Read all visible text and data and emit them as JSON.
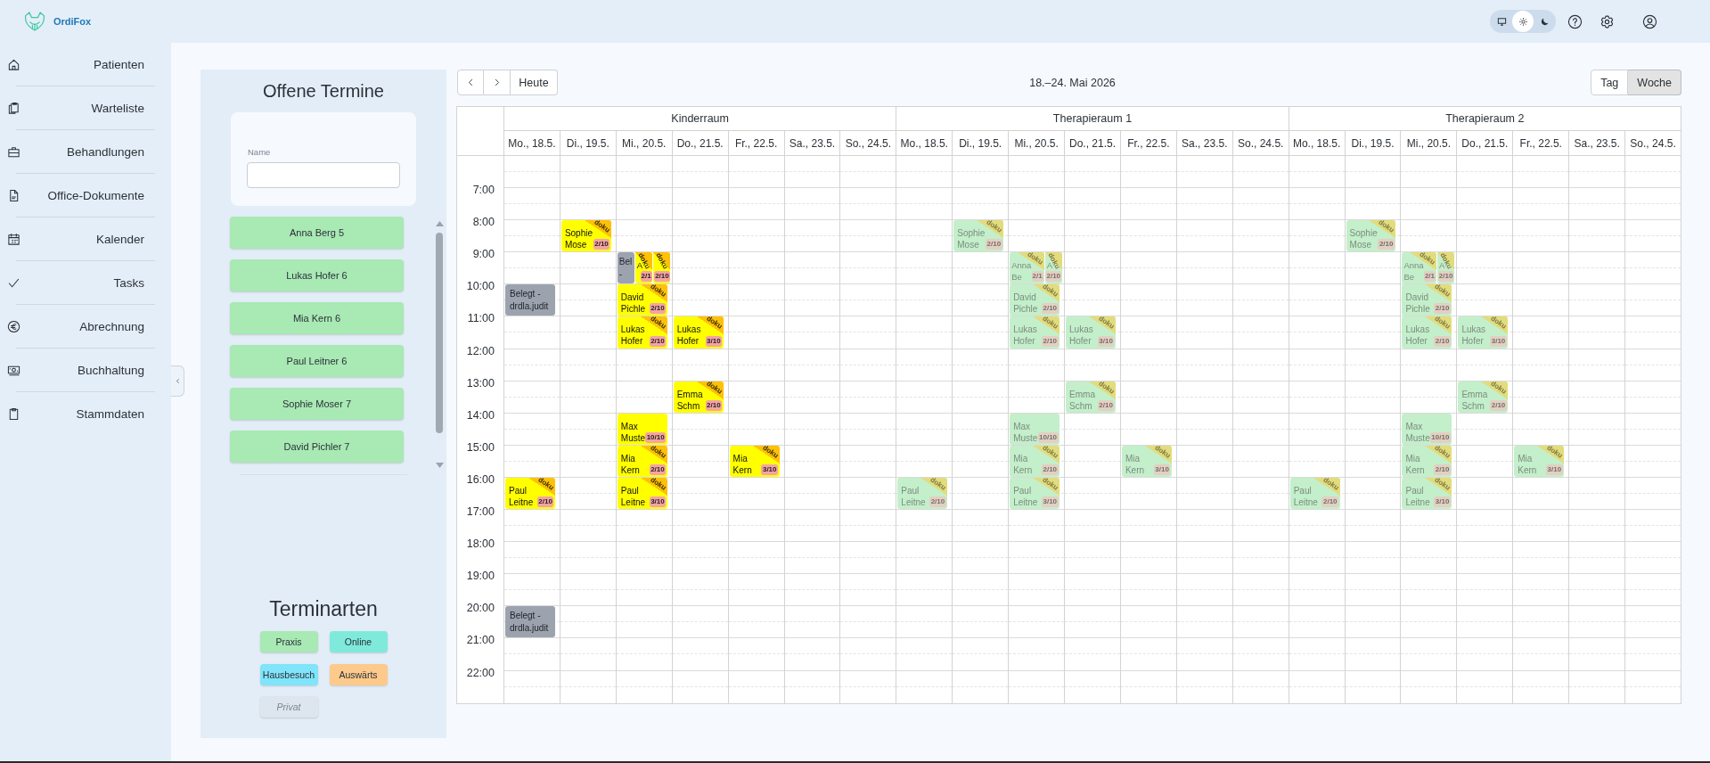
{
  "app": {
    "name": "OrdiFox"
  },
  "theme_modes": [
    {
      "kind": "system",
      "selected": false
    },
    {
      "kind": "light",
      "selected": true
    },
    {
      "kind": "dark",
      "selected": false
    }
  ],
  "sidebar": {
    "items": [
      "Patienten",
      "Warteliste",
      "Behandlungen",
      "Office-Dokumente",
      "Kalender",
      "Tasks",
      "Abrechnung",
      "Buchhaltung",
      "Stammdaten"
    ]
  },
  "open_appointments": {
    "title": "Offene Termine",
    "search_label": "Name",
    "items": [
      "Anna Berg 5",
      "Lukas Hofer 6",
      "Mia Kern 6",
      "Paul Leitner 6",
      "Sophie Moser 7",
      "David Pichler 7"
    ]
  },
  "appointment_types": {
    "title": "Terminarten",
    "items": [
      {
        "label": "Praxis",
        "color": "#a8e9b4",
        "disabled": false
      },
      {
        "label": "Online",
        "color": "#7feadb",
        "disabled": false
      },
      {
        "label": "Hausbesuch",
        "color": "#80e4fa",
        "disabled": false
      },
      {
        "label": "Auswärts",
        "color": "#fdca8c",
        "disabled": false
      },
      {
        "label": "Privat",
        "color": "#dde6ee",
        "disabled": true
      }
    ]
  },
  "calendar": {
    "today": "Heute",
    "title": "18.–24. Mai 2026",
    "views": [
      {
        "label": "Tag",
        "selected": false
      },
      {
        "label": "Woche",
        "selected": true
      }
    ],
    "time_labels": [
      "7:00",
      "8:00",
      "9:00",
      "10:00",
      "11:00",
      "12:00",
      "13:00",
      "14:00",
      "15:00",
      "16:00",
      "17:00",
      "18:00",
      "19:00",
      "20:00",
      "21:00",
      "22:00"
    ],
    "rooms": [
      {
        "name": "Kinderraum",
        "days": [
          {
            "label": "Mo., 18.5.",
            "hours": [
              {
                "kind": "free"
              },
              {
                "kind": "free"
              },
              {
                "kind": "free"
              },
              {
                "kind": "free"
              },
              {
                "kind": "booked",
                "events": [
                  {
                    "kind": "blocked",
                    "name": "Belegt - drdla.judit"
                  }
                ]
              },
              {
                "kind": "free"
              },
              {
                "kind": "free"
              },
              {
                "kind": "free"
              },
              {
                "kind": "free"
              },
              {
                "kind": "free"
              },
              {
                "kind": "booked",
                "events": [
                  {
                    "kind": "appointment",
                    "name": "Paul Leitne",
                    "count": "2/10",
                    "flag": "doku",
                    "highlighted": true
                  }
                ]
              },
              {
                "kind": "free"
              },
              {
                "kind": "free"
              },
              {
                "kind": "free"
              },
              {
                "kind": "booked",
                "events": [
                  {
                    "kind": "blocked",
                    "name": "Belegt - drdla.judit"
                  }
                ]
              },
              {
                "kind": "free"
              },
              {
                "kind": "free"
              }
            ]
          },
          {
            "label": "Di., 19.5.",
            "hours": [
              {
                "kind": "free"
              },
              {
                "kind": "free"
              },
              {
                "kind": "booked",
                "events": [
                  {
                    "kind": "appointment",
                    "name": "Sophie Mose",
                    "count": "2/10",
                    "flag": "doku",
                    "highlighted": true
                  }
                ]
              },
              {
                "kind": "free"
              },
              {
                "kind": "free"
              },
              {
                "kind": "free"
              },
              {
                "kind": "free"
              },
              {
                "kind": "free"
              },
              {
                "kind": "free"
              },
              {
                "kind": "free"
              },
              {
                "kind": "free"
              },
              {
                "kind": "free"
              },
              {
                "kind": "free"
              },
              {
                "kind": "free"
              },
              {
                "kind": "free"
              },
              {
                "kind": "free"
              },
              {
                "kind": "free"
              }
            ]
          },
          {
            "label": "Mi., 20.5.",
            "hours": [
              {
                "kind": "free"
              },
              {
                "kind": "free"
              },
              {
                "kind": "free"
              },
              {
                "kind": "booked",
                "events": [
                  {
                    "kind": "blocked",
                    "name": "Bel -"
                  },
                  {
                    "kind": "appointment",
                    "name": "A",
                    "count": "2/1",
                    "flag": "doku",
                    "highlighted": true
                  },
                  {
                    "kind": "appointment",
                    "count": "2/10",
                    "flag": "doku",
                    "highlighted": true
                  }
                ]
              },
              {
                "kind": "booked",
                "events": [
                  {
                    "kind": "appointment",
                    "name": "David Pichle",
                    "count": "2/10",
                    "flag": "doku",
                    "highlighted": true
                  }
                ]
              },
              {
                "kind": "booked",
                "events": [
                  {
                    "kind": "appointment",
                    "name": "Lukas Hofer",
                    "count": "2/10",
                    "flag": "doku",
                    "highlighted": true
                  }
                ]
              },
              {
                "kind": "free"
              },
              {
                "kind": "free"
              },
              {
                "kind": "booked",
                "events": [
                  {
                    "kind": "appointment",
                    "name": "Max Muste",
                    "count": "10/10",
                    "highlighted": true
                  }
                ]
              },
              {
                "kind": "booked",
                "events": [
                  {
                    "kind": "appointment",
                    "name": "Mia Kern",
                    "count": "2/10",
                    "flag": "doku",
                    "highlighted": true
                  }
                ]
              },
              {
                "kind": "booked",
                "events": [
                  {
                    "kind": "appointment",
                    "name": "Paul Leitne",
                    "count": "3/10",
                    "flag": "doku",
                    "highlighted": true
                  }
                ]
              },
              {
                "kind": "free"
              },
              {
                "kind": "free"
              },
              {
                "kind": "free"
              },
              {
                "kind": "free"
              },
              {
                "kind": "free"
              },
              {
                "kind": "free"
              }
            ]
          },
          {
            "label": "Do., 21.5.",
            "hours": [
              {
                "kind": "free"
              },
              {
                "kind": "free"
              },
              {
                "kind": "free"
              },
              {
                "kind": "free"
              },
              {
                "kind": "free"
              },
              {
                "kind": "booked",
                "events": [
                  {
                    "kind": "appointment",
                    "name": "Lukas Hofer",
                    "count": "3/10",
                    "flag": "doku",
                    "highlighted": true
                  }
                ]
              },
              {
                "kind": "free"
              },
              {
                "kind": "booked",
                "events": [
                  {
                    "kind": "appointment",
                    "name": "Emma Schm",
                    "count": "2/10",
                    "flag": "doku",
                    "highlighted": true
                  }
                ]
              },
              {
                "kind": "free"
              },
              {
                "kind": "free"
              },
              {
                "kind": "free"
              },
              {
                "kind": "free"
              },
              {
                "kind": "free"
              },
              {
                "kind": "free"
              },
              {
                "kind": "free"
              },
              {
                "kind": "free"
              },
              {
                "kind": "free"
              }
            ]
          },
          {
            "label": "Fr., 22.5.",
            "hours": [
              {
                "kind": "free"
              },
              {
                "kind": "free"
              },
              {
                "kind": "free"
              },
              {
                "kind": "free"
              },
              {
                "kind": "free"
              },
              {
                "kind": "free"
              },
              {
                "kind": "free"
              },
              {
                "kind": "free"
              },
              {
                "kind": "free"
              },
              {
                "kind": "booked",
                "events": [
                  {
                    "kind": "appointment",
                    "name": "Mia Kern",
                    "count": "3/10",
                    "flag": "doku",
                    "highlighted": true
                  }
                ]
              },
              {
                "kind": "free"
              },
              {
                "kind": "free"
              },
              {
                "kind": "free"
              },
              {
                "kind": "free"
              },
              {
                "kind": "free"
              },
              {
                "kind": "free"
              },
              {
                "kind": "free"
              }
            ]
          },
          {
            "label": "Sa., 23.5.",
            "hours": [
              {
                "kind": "free"
              },
              {
                "kind": "free"
              },
              {
                "kind": "free"
              },
              {
                "kind": "free"
              },
              {
                "kind": "free"
              },
              {
                "kind": "free"
              },
              {
                "kind": "free"
              },
              {
                "kind": "free"
              },
              {
                "kind": "free"
              },
              {
                "kind": "free"
              },
              {
                "kind": "free"
              },
              {
                "kind": "free"
              },
              {
                "kind": "free"
              },
              {
                "kind": "free"
              },
              {
                "kind": "free"
              },
              {
                "kind": "free"
              },
              {
                "kind": "free"
              }
            ]
          },
          {
            "label": "So., 24.5.",
            "hours": [
              {
                "kind": "free"
              },
              {
                "kind": "free"
              },
              {
                "kind": "free"
              },
              {
                "kind": "free"
              },
              {
                "kind": "free"
              },
              {
                "kind": "free"
              },
              {
                "kind": "free"
              },
              {
                "kind": "free"
              },
              {
                "kind": "free"
              },
              {
                "kind": "free"
              },
              {
                "kind": "free"
              },
              {
                "kind": "free"
              },
              {
                "kind": "free"
              },
              {
                "kind": "free"
              },
              {
                "kind": "free"
              },
              {
                "kind": "free"
              },
              {
                "kind": "free"
              }
            ]
          }
        ]
      },
      {
        "name": "Therapieraum 1",
        "days": [
          {
            "label": "Mo., 18.5.",
            "hours": [
              {
                "kind": "free"
              },
              {
                "kind": "free"
              },
              {
                "kind": "free"
              },
              {
                "kind": "free"
              },
              {
                "kind": "free"
              },
              {
                "kind": "free"
              },
              {
                "kind": "free"
              },
              {
                "kind": "free"
              },
              {
                "kind": "free"
              },
              {
                "kind": "free"
              },
              {
                "kind": "booked",
                "events": [
                  {
                    "kind": "appointment",
                    "name": "Paul Leitne",
                    "count": "2/10",
                    "flag": "doku",
                    "highlighted": false
                  }
                ]
              },
              {
                "kind": "free"
              },
              {
                "kind": "free"
              },
              {
                "kind": "free"
              },
              {
                "kind": "free"
              },
              {
                "kind": "free"
              },
              {
                "kind": "free"
              }
            ]
          },
          {
            "label": "Di., 19.5.",
            "hours": [
              {
                "kind": "free"
              },
              {
                "kind": "free"
              },
              {
                "kind": "booked",
                "events": [
                  {
                    "kind": "appointment",
                    "name": "Sophie Mose",
                    "count": "2/10",
                    "flag": "doku",
                    "highlighted": false
                  }
                ]
              },
              {
                "kind": "free"
              },
              {
                "kind": "free"
              },
              {
                "kind": "free"
              },
              {
                "kind": "free"
              },
              {
                "kind": "free"
              },
              {
                "kind": "free"
              },
              {
                "kind": "free"
              },
              {
                "kind": "free"
              },
              {
                "kind": "free"
              },
              {
                "kind": "free"
              },
              {
                "kind": "free"
              },
              {
                "kind": "free"
              },
              {
                "kind": "free"
              },
              {
                "kind": "free"
              }
            ]
          },
          {
            "label": "Mi., 20.5.",
            "hours": [
              {
                "kind": "free"
              },
              {
                "kind": "free"
              },
              {
                "kind": "free"
              },
              {
                "kind": "booked",
                "events": [
                  {
                    "kind": "appointment",
                    "name": "Anna Be",
                    "count": "2/1",
                    "flag": "doku",
                    "highlighted": false
                  },
                  {
                    "kind": "appointment",
                    "name": "A",
                    "count": "2/10",
                    "flag": "doku",
                    "highlighted": false
                  }
                ]
              },
              {
                "kind": "booked",
                "events": [
                  {
                    "kind": "appointment",
                    "name": "David Pichle",
                    "count": "2/10",
                    "flag": "doku",
                    "highlighted": false
                  }
                ]
              },
              {
                "kind": "booked",
                "events": [
                  {
                    "kind": "appointment",
                    "name": "Lukas Hofer",
                    "count": "2/10",
                    "flag": "doku",
                    "highlighted": false
                  }
                ]
              },
              {
                "kind": "free"
              },
              {
                "kind": "free"
              },
              {
                "kind": "booked",
                "events": [
                  {
                    "kind": "appointment",
                    "name": "Max Muste",
                    "count": "10/10",
                    "highlighted": false
                  }
                ]
              },
              {
                "kind": "booked",
                "events": [
                  {
                    "kind": "appointment",
                    "name": "Mia Kern",
                    "count": "2/10",
                    "flag": "doku",
                    "highlighted": false
                  }
                ]
              },
              {
                "kind": "booked",
                "events": [
                  {
                    "kind": "appointment",
                    "name": "Paul Leitne",
                    "count": "3/10",
                    "flag": "doku",
                    "highlighted": false
                  }
                ]
              },
              {
                "kind": "free"
              },
              {
                "kind": "free"
              },
              {
                "kind": "free"
              },
              {
                "kind": "free"
              },
              {
                "kind": "free"
              },
              {
                "kind": "free"
              }
            ]
          },
          {
            "label": "Do., 21.5.",
            "hours": [
              {
                "kind": "free"
              },
              {
                "kind": "free"
              },
              {
                "kind": "free"
              },
              {
                "kind": "free"
              },
              {
                "kind": "free"
              },
              {
                "kind": "booked",
                "events": [
                  {
                    "kind": "appointment",
                    "name": "Lukas Hofer",
                    "count": "3/10",
                    "flag": "doku",
                    "highlighted": false
                  }
                ]
              },
              {
                "kind": "free"
              },
              {
                "kind": "booked",
                "events": [
                  {
                    "kind": "appointment",
                    "name": "Emma Schm",
                    "count": "2/10",
                    "flag": "doku",
                    "highlighted": false
                  }
                ]
              },
              {
                "kind": "free"
              },
              {
                "kind": "free"
              },
              {
                "kind": "free"
              },
              {
                "kind": "free"
              },
              {
                "kind": "free"
              },
              {
                "kind": "free"
              },
              {
                "kind": "free"
              },
              {
                "kind": "free"
              },
              {
                "kind": "free"
              }
            ]
          },
          {
            "label": "Fr., 22.5.",
            "hours": [
              {
                "kind": "free"
              },
              {
                "kind": "free"
              },
              {
                "kind": "free"
              },
              {
                "kind": "free"
              },
              {
                "kind": "free"
              },
              {
                "kind": "free"
              },
              {
                "kind": "free"
              },
              {
                "kind": "free"
              },
              {
                "kind": "free"
              },
              {
                "kind": "booked",
                "events": [
                  {
                    "kind": "appointment",
                    "name": "Mia Kern",
                    "count": "3/10",
                    "flag": "doku",
                    "highlighted": false
                  }
                ]
              },
              {
                "kind": "free"
              },
              {
                "kind": "free"
              },
              {
                "kind": "free"
              },
              {
                "kind": "free"
              },
              {
                "kind": "free"
              },
              {
                "kind": "free"
              },
              {
                "kind": "free"
              }
            ]
          },
          {
            "label": "Sa., 23.5.",
            "hours": [
              {
                "kind": "free"
              },
              {
                "kind": "free"
              },
              {
                "kind": "free"
              },
              {
                "kind": "free"
              },
              {
                "kind": "free"
              },
              {
                "kind": "free"
              },
              {
                "kind": "free"
              },
              {
                "kind": "free"
              },
              {
                "kind": "free"
              },
              {
                "kind": "free"
              },
              {
                "kind": "free"
              },
              {
                "kind": "free"
              },
              {
                "kind": "free"
              },
              {
                "kind": "free"
              },
              {
                "kind": "free"
              },
              {
                "kind": "free"
              },
              {
                "kind": "free"
              }
            ]
          },
          {
            "label": "So., 24.5.",
            "hours": [
              {
                "kind": "free"
              },
              {
                "kind": "free"
              },
              {
                "kind": "free"
              },
              {
                "kind": "free"
              },
              {
                "kind": "free"
              },
              {
                "kind": "free"
              },
              {
                "kind": "free"
              },
              {
                "kind": "free"
              },
              {
                "kind": "free"
              },
              {
                "kind": "free"
              },
              {
                "kind": "free"
              },
              {
                "kind": "free"
              },
              {
                "kind": "free"
              },
              {
                "kind": "free"
              },
              {
                "kind": "free"
              },
              {
                "kind": "free"
              },
              {
                "kind": "free"
              }
            ]
          }
        ]
      },
      {
        "name": "Therapieraum 2",
        "days": [
          {
            "label": "Mo., 18.5.",
            "hours": [
              {
                "kind": "free"
              },
              {
                "kind": "free"
              },
              {
                "kind": "free"
              },
              {
                "kind": "free"
              },
              {
                "kind": "free"
              },
              {
                "kind": "free"
              },
              {
                "kind": "free"
              },
              {
                "kind": "free"
              },
              {
                "kind": "free"
              },
              {
                "kind": "free"
              },
              {
                "kind": "booked",
                "events": [
                  {
                    "kind": "appointment",
                    "name": "Paul Leitne",
                    "count": "2/10",
                    "flag": "doku",
                    "highlighted": false
                  }
                ]
              },
              {
                "kind": "free"
              },
              {
                "kind": "free"
              },
              {
                "kind": "free"
              },
              {
                "kind": "free"
              },
              {
                "kind": "free"
              },
              {
                "kind": "free"
              }
            ]
          },
          {
            "label": "Di., 19.5.",
            "hours": [
              {
                "kind": "free"
              },
              {
                "kind": "free"
              },
              {
                "kind": "booked",
                "events": [
                  {
                    "kind": "appointment",
                    "name": "Sophie Mose",
                    "count": "2/10",
                    "flag": "doku",
                    "highlighted": false
                  }
                ]
              },
              {
                "kind": "free"
              },
              {
                "kind": "free"
              },
              {
                "kind": "free"
              },
              {
                "kind": "free"
              },
              {
                "kind": "free"
              },
              {
                "kind": "free"
              },
              {
                "kind": "free"
              },
              {
                "kind": "free"
              },
              {
                "kind": "free"
              },
              {
                "kind": "free"
              },
              {
                "kind": "free"
              },
              {
                "kind": "free"
              },
              {
                "kind": "free"
              },
              {
                "kind": "free"
              }
            ]
          },
          {
            "label": "Mi., 20.5.",
            "hours": [
              {
                "kind": "free"
              },
              {
                "kind": "free"
              },
              {
                "kind": "free"
              },
              {
                "kind": "booked",
                "events": [
                  {
                    "kind": "appointment",
                    "name": "Anna Be",
                    "count": "2/1",
                    "flag": "doku",
                    "highlighted": false
                  },
                  {
                    "kind": "appointment",
                    "name": "A",
                    "count": "2/10",
                    "flag": "doku",
                    "highlighted": false
                  }
                ]
              },
              {
                "kind": "booked",
                "events": [
                  {
                    "kind": "appointment",
                    "name": "David Pichle",
                    "count": "2/10",
                    "flag": "doku",
                    "highlighted": false
                  }
                ]
              },
              {
                "kind": "booked",
                "events": [
                  {
                    "kind": "appointment",
                    "name": "Lukas Hofer",
                    "count": "2/10",
                    "flag": "doku",
                    "highlighted": false
                  }
                ]
              },
              {
                "kind": "free"
              },
              {
                "kind": "free"
              },
              {
                "kind": "booked",
                "events": [
                  {
                    "kind": "appointment",
                    "name": "Max Muste",
                    "count": "10/10",
                    "highlighted": false
                  }
                ]
              },
              {
                "kind": "booked",
                "events": [
                  {
                    "kind": "appointment",
                    "name": "Mia Kern",
                    "count": "2/10",
                    "flag": "doku",
                    "highlighted": false
                  }
                ]
              },
              {
                "kind": "booked",
                "events": [
                  {
                    "kind": "appointment",
                    "name": "Paul Leitne",
                    "count": "3/10",
                    "flag": "doku",
                    "highlighted": false
                  }
                ]
              },
              {
                "kind": "free"
              },
              {
                "kind": "free"
              },
              {
                "kind": "free"
              },
              {
                "kind": "free"
              },
              {
                "kind": "free"
              },
              {
                "kind": "free"
              }
            ]
          },
          {
            "label": "Do., 21.5.",
            "hours": [
              {
                "kind": "free"
              },
              {
                "kind": "free"
              },
              {
                "kind": "free"
              },
              {
                "kind": "free"
              },
              {
                "kind": "free"
              },
              {
                "kind": "booked",
                "events": [
                  {
                    "kind": "appointment",
                    "name": "Lukas Hofer",
                    "count": "3/10",
                    "flag": "doku",
                    "highlighted": false
                  }
                ]
              },
              {
                "kind": "free"
              },
              {
                "kind": "booked",
                "events": [
                  {
                    "kind": "appointment",
                    "name": "Emma Schm",
                    "count": "2/10",
                    "flag": "doku",
                    "highlighted": false
                  }
                ]
              },
              {
                "kind": "free"
              },
              {
                "kind": "free"
              },
              {
                "kind": "free"
              },
              {
                "kind": "free"
              },
              {
                "kind": "free"
              },
              {
                "kind": "free"
              },
              {
                "kind": "free"
              },
              {
                "kind": "free"
              },
              {
                "kind": "free"
              }
            ]
          },
          {
            "label": "Fr., 22.5.",
            "hours": [
              {
                "kind": "free"
              },
              {
                "kind": "free"
              },
              {
                "kind": "free"
              },
              {
                "kind": "free"
              },
              {
                "kind": "free"
              },
              {
                "kind": "free"
              },
              {
                "kind": "free"
              },
              {
                "kind": "free"
              },
              {
                "kind": "free"
              },
              {
                "kind": "booked",
                "events": [
                  {
                    "kind": "appointment",
                    "name": "Mia Kern",
                    "count": "3/10",
                    "flag": "doku",
                    "highlighted": false
                  }
                ]
              },
              {
                "kind": "free"
              },
              {
                "kind": "free"
              },
              {
                "kind": "free"
              },
              {
                "kind": "free"
              },
              {
                "kind": "free"
              },
              {
                "kind": "free"
              },
              {
                "kind": "free"
              }
            ]
          },
          {
            "label": "Sa., 23.5.",
            "hours": [
              {
                "kind": "free"
              },
              {
                "kind": "free"
              },
              {
                "kind": "free"
              },
              {
                "kind": "free"
              },
              {
                "kind": "free"
              },
              {
                "kind": "free"
              },
              {
                "kind": "free"
              },
              {
                "kind": "free"
              },
              {
                "kind": "free"
              },
              {
                "kind": "free"
              },
              {
                "kind": "free"
              },
              {
                "kind": "free"
              },
              {
                "kind": "free"
              },
              {
                "kind": "free"
              },
              {
                "kind": "free"
              },
              {
                "kind": "free"
              },
              {
                "kind": "free"
              }
            ]
          },
          {
            "label": "So., 24.5.",
            "hours": [
              {
                "kind": "free"
              },
              {
                "kind": "free"
              },
              {
                "kind": "free"
              },
              {
                "kind": "free"
              },
              {
                "kind": "free"
              },
              {
                "kind": "free"
              },
              {
                "kind": "free"
              },
              {
                "kind": "free"
              },
              {
                "kind": "free"
              },
              {
                "kind": "free"
              },
              {
                "kind": "free"
              },
              {
                "kind": "free"
              },
              {
                "kind": "free"
              },
              {
                "kind": "free"
              },
              {
                "kind": "free"
              },
              {
                "kind": "free"
              },
              {
                "kind": "free"
              }
            ]
          }
        ]
      }
    ]
  }
}
